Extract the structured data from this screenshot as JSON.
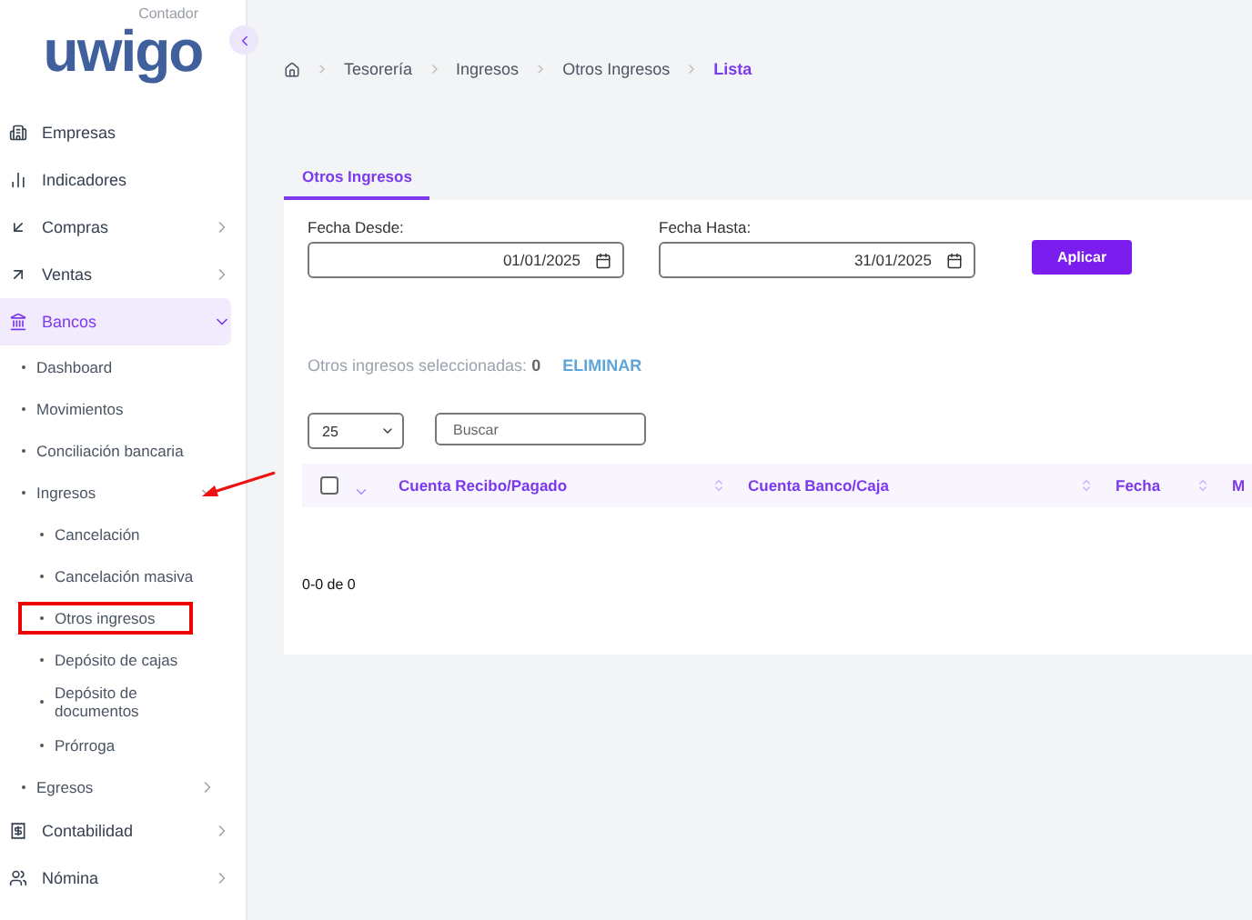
{
  "logo": {
    "brand": "uwigo",
    "tag": "Contador"
  },
  "sidebar": {
    "items": [
      {
        "label": "Empresas",
        "selected": false
      },
      {
        "label": "Indicadores",
        "selected": false
      },
      {
        "label": "Compras",
        "selected": false,
        "expanded": false
      },
      {
        "label": "Ventas",
        "selected": false,
        "expanded": false
      },
      {
        "label": "Bancos",
        "selected": true,
        "expanded": true,
        "children": [
          {
            "label": "Dashboard"
          },
          {
            "label": "Movimientos"
          },
          {
            "label": "Conciliación bancaria"
          },
          {
            "label": "Ingresos",
            "expanded": true,
            "children": [
              {
                "label": "Cancelación",
                "marked": false
              },
              {
                "label": "Cancelación masiva",
                "marked": false
              },
              {
                "label": "Otros ingresos",
                "marked": true
              },
              {
                "label": "Depósito de cajas",
                "marked": false
              },
              {
                "label": "Depósito de documentos",
                "marked": false
              },
              {
                "label": "Prórroga",
                "marked": false
              }
            ]
          },
          {
            "label": "Egresos",
            "expanded": false
          }
        ]
      },
      {
        "label": "Contabilidad",
        "selected": false,
        "expanded": false
      },
      {
        "label": "Nómina",
        "selected": false,
        "expanded": false
      }
    ]
  },
  "breadcrumb": [
    {
      "label": "Tesorería",
      "selected": false
    },
    {
      "label": "Ingresos",
      "selected": false
    },
    {
      "label": "Otros Ingresos",
      "selected": false
    },
    {
      "label": "Lista",
      "selected": true
    }
  ],
  "tabs": [
    {
      "label": "Otros Ingresos",
      "selected": true
    }
  ],
  "filters": [
    {
      "label": "Fecha Desde:",
      "value": "01/01/2025"
    },
    {
      "label": "Fecha Hasta:",
      "value": "31/01/2025"
    }
  ],
  "apply_button": "Aplicar",
  "selection": {
    "text": "Otros ingresos seleccionadas:",
    "count": "0",
    "action": "ELIMINAR"
  },
  "page_size": "25",
  "search": {
    "placeholder": "Buscar"
  },
  "table": {
    "select_all": false,
    "columns": [
      {
        "label": "Cuenta Recibo/Pagado"
      },
      {
        "label": "Cuenta Banco/Caja"
      },
      {
        "label": "Fecha"
      },
      {
        "label": "M"
      }
    ]
  },
  "pagination": "0-0 de 0"
}
